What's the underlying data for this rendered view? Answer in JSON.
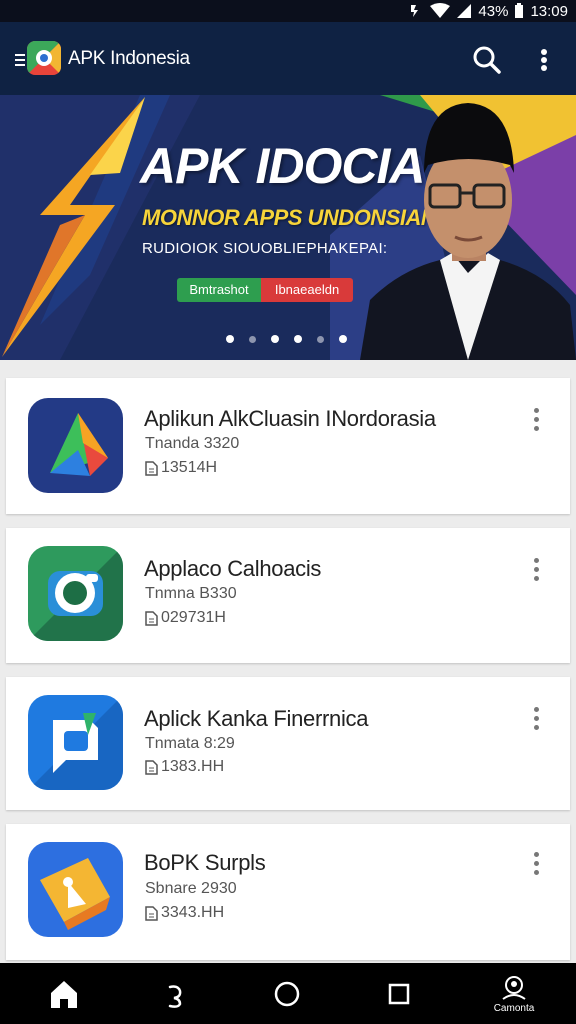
{
  "status_bar": {
    "battery": "43%",
    "time": "13:09"
  },
  "app_bar": {
    "title": "APK Indonesia",
    "icons": [
      "menu-icon",
      "app-logo",
      "search-icon",
      "more-vert-icon"
    ]
  },
  "banner": {
    "title": "APK IDOCIA",
    "subtitle": "MONNOR APPS UNDONSIAN",
    "tagline": "RUDIOIOK SIOUOBLIEPHAKEPAI:",
    "button_green": "Bmtrashot",
    "button_red": "Ibnaeaeldn",
    "slides": 6,
    "active_slides": [
      3,
      4,
      6
    ]
  },
  "apps": [
    {
      "name": "Aplikun AlkCluasin INordorasia",
      "meta": "Tnanda 3320",
      "size": "13514H"
    },
    {
      "name": "Applaco Calhoacis",
      "meta": "Tnmna B330",
      "size": "029731H"
    },
    {
      "name": "Aplick Kanka Finerrnica",
      "meta": "Tnmata 8:29",
      "size": "1383.HH"
    },
    {
      "name": "BoPK Surpls",
      "meta": "Sbnare 2930",
      "size": "3343.HH"
    }
  ],
  "nav": {
    "last_label": "Camonta",
    "icons": [
      "home-icon",
      "back-icon",
      "circle-home-icon",
      "recents-icon",
      "account-icon"
    ]
  },
  "colors": {
    "app_bar": "#0f2243",
    "status_bar": "#0b0f1c",
    "banner_green": "#2e9e4f",
    "banner_red": "#d93a3a",
    "banner_title_yellow": "#f7d43a"
  }
}
